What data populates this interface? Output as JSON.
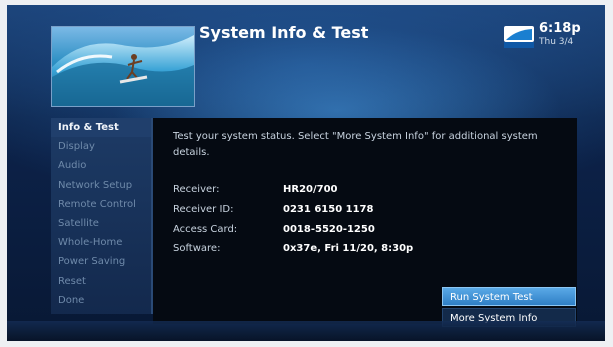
{
  "header": {
    "title": "System Info & Test",
    "logo_name": "DIRECTV",
    "time": "6:18p",
    "date": "Thu 3/4"
  },
  "menu": {
    "items": [
      {
        "label": "Info & Test",
        "active": true
      },
      {
        "label": "Display"
      },
      {
        "label": "Audio"
      },
      {
        "label": "Network Setup"
      },
      {
        "label": "Remote Control"
      },
      {
        "label": "Satellite"
      },
      {
        "label": "Whole-Home"
      },
      {
        "label": "Power Saving"
      },
      {
        "label": "Reset"
      },
      {
        "label": "Done"
      }
    ]
  },
  "content": {
    "description": "Test your system status. Select \"More System Info\" for additional system details.",
    "info": [
      {
        "label": "Receiver:",
        "value": "HR20/700"
      },
      {
        "label": "Receiver ID:",
        "value": "0231 6150 1178"
      },
      {
        "label": "Access Card:",
        "value": "0018-5520-1250"
      },
      {
        "label": "Software:",
        "value": "0x37e, Fri 11/20, 8:30p"
      }
    ],
    "buttons": {
      "run_test": "Run System Test",
      "more_info": "More System Info"
    }
  },
  "colors": {
    "accent": "#3f93d6",
    "background": "#0c2147",
    "panel": "#050a12"
  }
}
